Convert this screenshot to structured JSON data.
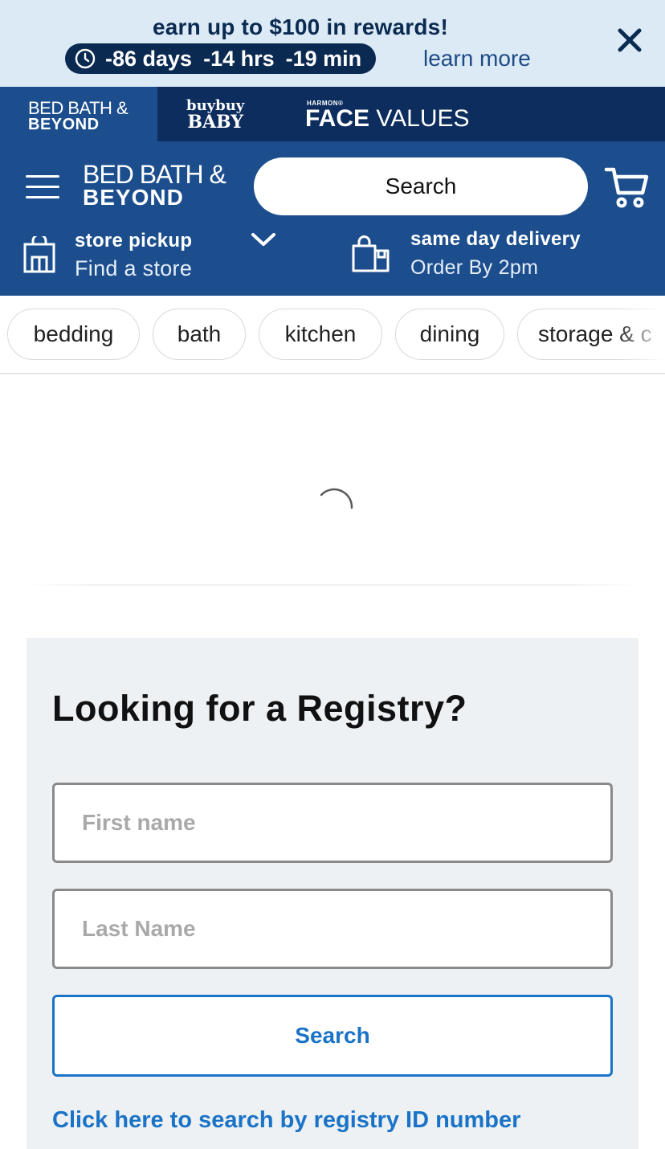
{
  "promo": {
    "title": "earn up to $100 in rewards!",
    "countdown": {
      "days": "-86 days",
      "hours": "-14 hrs",
      "minutes": "-19 min"
    },
    "learn_more": "learn more"
  },
  "brands": {
    "bbb_line1": "BED BATH &",
    "bbb_line2": "BEYOND",
    "baby_line1": "buybuy",
    "baby_line2": "BABY",
    "fv_small": "HARMON®",
    "fv_bold": "FACE",
    "fv_light": "VALUES"
  },
  "header": {
    "logo_line1": "BED BATH &",
    "logo_line2": "BEYOND",
    "search_label": "Search",
    "pickup_title": "store pickup",
    "pickup_sub": "Find a store",
    "delivery_title": "same day delivery",
    "delivery_sub": "Order By 2pm"
  },
  "categories": [
    "bedding",
    "bath",
    "kitchen",
    "dining",
    "storage & c"
  ],
  "registry": {
    "title": "Looking for a Registry?",
    "first_name_placeholder": "First name",
    "last_name_placeholder": "Last Name",
    "search_label": "Search",
    "id_link": "Click here to search by registry ID number"
  },
  "colors": {
    "promo_bg": "#dbeaf5",
    "navy": "#0b2a52",
    "header_blue": "#1c4e8e",
    "link_blue": "#1a73c7",
    "panel_bg": "#edf1f3"
  }
}
